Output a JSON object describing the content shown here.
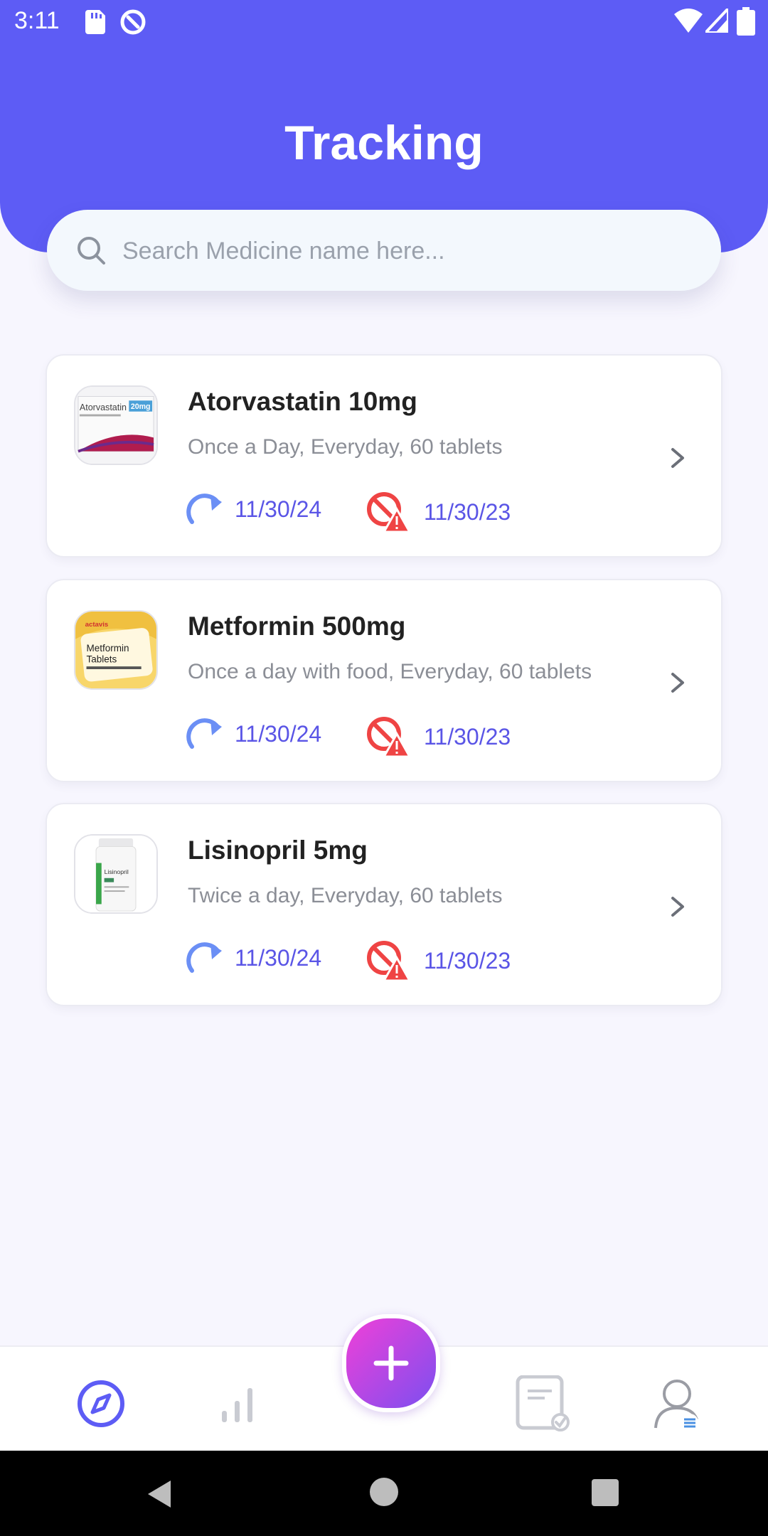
{
  "status_bar": {
    "time": "3:11"
  },
  "header": {
    "title": "Tracking"
  },
  "search": {
    "placeholder": "Search Medicine name here..."
  },
  "colors": {
    "brand": "#5d5cf5",
    "date_text": "#5a55e6",
    "refill_icon": "#6b8ff5",
    "expiry_icon": "#ef4444"
  },
  "medications": [
    {
      "name": "Atorvastatin 10mg",
      "description": "Once a Day, Everyday, 60 tablets",
      "refill_date": "11/30/24",
      "expiry_date": "11/30/23",
      "thumb_text": "Atorvastatin",
      "thumb_badge": "20mg"
    },
    {
      "name": "Metformin 500mg",
      "description": "Once a day with food, Everyday, 60 tablets",
      "refill_date": "11/30/24",
      "expiry_date": "11/30/23",
      "thumb_brand": "actavis",
      "thumb_line1": "Metformin",
      "thumb_line2": "Tablets"
    },
    {
      "name": "Lisinopril 5mg",
      "description": "Twice a day, Everyday, 60 tablets",
      "refill_date": "11/30/24",
      "expiry_date": "11/30/23",
      "thumb_text": "Lisinopril"
    }
  ],
  "bottom_nav": {
    "items": [
      {
        "icon": "compass-icon",
        "active": true
      },
      {
        "icon": "bar-chart-icon",
        "active": false
      },
      {
        "icon": "add-icon",
        "active": false
      },
      {
        "icon": "document-check-icon",
        "active": false
      },
      {
        "icon": "user-list-icon",
        "active": false
      }
    ]
  }
}
